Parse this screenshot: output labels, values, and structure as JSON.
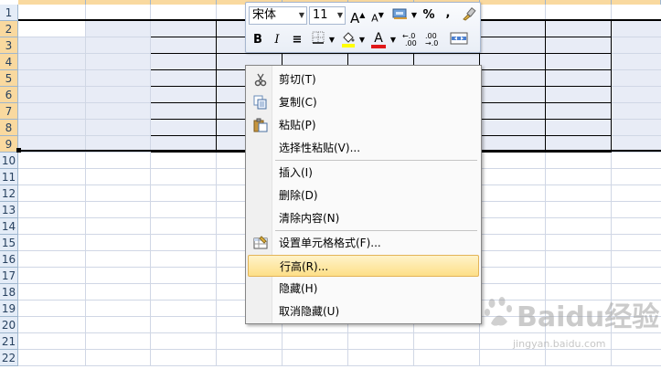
{
  "row_numbers": [
    "1",
    "2",
    "3",
    "4",
    "5",
    "6",
    "7",
    "8",
    "9",
    "10",
    "11",
    "12",
    "13",
    "14",
    "15",
    "16",
    "17",
    "18",
    "19",
    "20",
    "21",
    "22"
  ],
  "mini_toolbar": {
    "font_name": "宋体",
    "font_size": "11",
    "grow_font": "A",
    "shrink_font": "A",
    "percent": "%",
    "comma": ",",
    "bold": "B",
    "italic": "I",
    "align_center": "≡",
    "font_color_letter": "A",
    "inc_decimal": "+.0\n.00",
    "dec_decimal": ".00\n+.0"
  },
  "context_menu": {
    "items": [
      {
        "label": "剪切(T)",
        "icon": "scissors-icon"
      },
      {
        "label": "复制(C)",
        "icon": "copy-icon"
      },
      {
        "label": "粘贴(P)",
        "icon": "paste-icon"
      },
      {
        "label": "选择性粘贴(V)...",
        "icon": ""
      },
      {
        "label": "插入(I)",
        "icon": ""
      },
      {
        "label": "删除(D)",
        "icon": ""
      },
      {
        "label": "清除内容(N)",
        "icon": ""
      },
      {
        "label": "设置单元格格式(F)...",
        "icon": "format-cells-icon"
      },
      {
        "label": "行高(R)...",
        "icon": ""
      },
      {
        "label": "隐藏(H)",
        "icon": ""
      },
      {
        "label": "取消隐藏(U)",
        "icon": ""
      }
    ],
    "highlighted": "行高(R)..."
  },
  "watermark": {
    "logo_text": "Baidu经验",
    "url": "jingyan.baidu.com"
  },
  "colors": {
    "selection_fill": "#e8ecf6",
    "header_selected": "#f9d99f",
    "menu_highlight": "#fddf87"
  }
}
